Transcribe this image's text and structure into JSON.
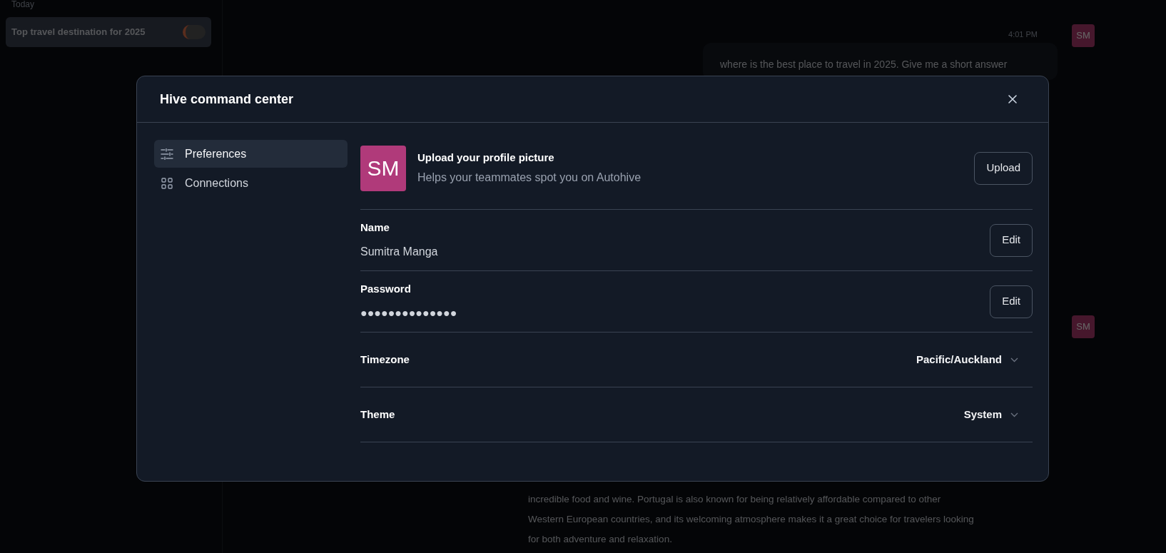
{
  "background": {
    "sidebar": {
      "section": "Today",
      "chats": [
        {
          "title": "Top travel destination for 2025",
          "selected": true
        }
      ]
    },
    "messages": [
      {
        "kind": "user",
        "time": "4:01 PM",
        "avatar": "SM",
        "text": "where is the best place to travel in 2025. Give me a short answer"
      },
      {
        "kind": "assistant",
        "avatar": "SM",
        "lines": [
          "incredible food and wine. Portugal is also known for being relatively affordable compared to other",
          "Western European countries, and its welcoming atmosphere makes it a great choice for travelers looking",
          "for both adventure and relaxation."
        ]
      }
    ]
  },
  "dialog": {
    "title": "Hive command center",
    "nav": [
      {
        "label": "Preferences",
        "selected": true
      },
      {
        "label": "Connections",
        "selected": false
      }
    ],
    "profile": {
      "avatar": "SM",
      "title": "Upload your profile picture",
      "subtitle": "Helps your teammates spot you on Autohive",
      "button": "Upload"
    },
    "fields": [
      {
        "kind": "text",
        "label": "Name",
        "value": "Sumitra Manga",
        "button": "Edit"
      },
      {
        "kind": "text",
        "label": "Password",
        "value": "●●●●●●●●●●●●●●",
        "button": "Edit"
      },
      {
        "kind": "select",
        "label": "Timezone",
        "value": "Pacific/Auckland"
      },
      {
        "kind": "select",
        "label": "Theme",
        "value": "System"
      }
    ]
  }
}
